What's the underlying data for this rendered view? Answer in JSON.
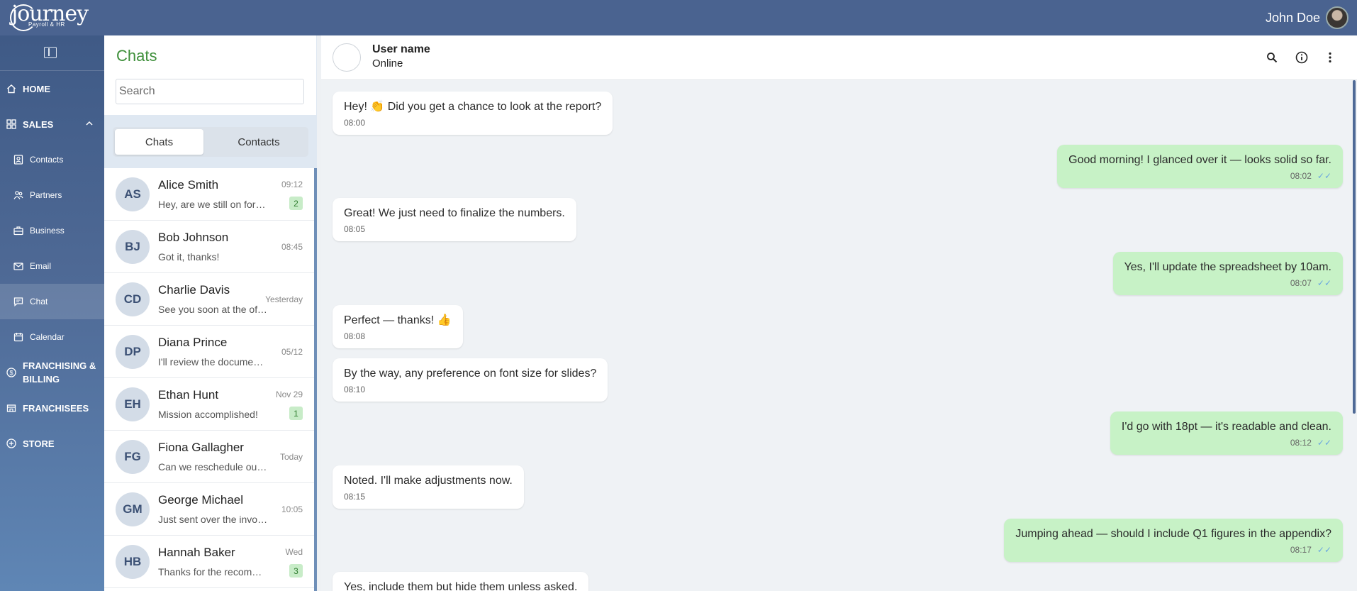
{
  "app": {
    "logo_text": "journey",
    "logo_subtitle": "Payroll & HR"
  },
  "topbar": {
    "user_name": "John Doe"
  },
  "sidebar": {
    "items": [
      {
        "label": "HOME",
        "icon": "home-icon"
      },
      {
        "label": "SALES",
        "icon": "grid-icon"
      },
      {
        "label": "Contacts",
        "icon": "contact-card-icon"
      },
      {
        "label": "Partners",
        "icon": "partners-icon"
      },
      {
        "label": "Business",
        "icon": "briefcase-icon"
      },
      {
        "label": "Email",
        "icon": "mail-icon"
      },
      {
        "label": "Chat",
        "icon": "chat-icon"
      },
      {
        "label": "Calendar",
        "icon": "calendar-icon"
      },
      {
        "label": "FRANCHISING & BILLING",
        "icon": "dollar-icon"
      },
      {
        "label": "FRANCHISEES",
        "icon": "store-icon"
      },
      {
        "label": "STORE",
        "icon": "plus-circle-icon"
      }
    ]
  },
  "chat_panel": {
    "title": "Chats",
    "search_placeholder": "Search",
    "tabs": [
      {
        "label": "Chats",
        "active": true
      },
      {
        "label": "Contacts",
        "active": false
      }
    ],
    "chats": [
      {
        "initials": "AS",
        "name": "Alice Smith",
        "preview": "Hey, are we still on for lunch?",
        "time": "09:12",
        "unread": "2"
      },
      {
        "initials": "BJ",
        "name": "Bob Johnson",
        "preview": "Got it, thanks!",
        "time": "08:45",
        "unread": ""
      },
      {
        "initials": "CD",
        "name": "Charlie Davis",
        "preview": "See you soon at the office",
        "time": "Yesterday",
        "unread": ""
      },
      {
        "initials": "DP",
        "name": "Diana Prince",
        "preview": "I'll review the documents tonight",
        "time": "05/12",
        "unread": ""
      },
      {
        "initials": "EH",
        "name": "Ethan Hunt",
        "preview": "Mission accomplished!",
        "time": "Nov 29",
        "unread": "1"
      },
      {
        "initials": "FG",
        "name": "Fiona Gallagher",
        "preview": "Can we reschedule our call?",
        "time": "Today",
        "unread": ""
      },
      {
        "initials": "GM",
        "name": "George Michael",
        "preview": "Just sent over the invoice",
        "time": "10:05",
        "unread": ""
      },
      {
        "initials": "HB",
        "name": "Hannah Baker",
        "preview": "Thanks for the recommendation",
        "time": "Wed",
        "unread": "3"
      }
    ]
  },
  "conversation": {
    "contact_name": "User name",
    "contact_status": "Online",
    "messages": [
      {
        "dir": "in",
        "text": "Hey! 👏 Did you get a chance to look at the report?",
        "time": "08:00"
      },
      {
        "dir": "out",
        "text": "Good morning! I glanced over it — looks solid so far.",
        "time": "08:02"
      },
      {
        "dir": "in",
        "text": "Great! We just need to finalize the numbers.",
        "time": "08:05"
      },
      {
        "dir": "out",
        "text": "Yes, I'll update the spreadsheet by 10am.",
        "time": "08:07"
      },
      {
        "dir": "in",
        "text": "Perfect — thanks! 👍",
        "time": "08:08"
      },
      {
        "dir": "in",
        "text": "By the way, any preference on font size for slides?",
        "time": "08:10"
      },
      {
        "dir": "out",
        "text": "I'd go with 18pt — it's readable and clean.",
        "time": "08:12"
      },
      {
        "dir": "in",
        "text": "Noted. I'll make adjustments now.",
        "time": "08:15"
      },
      {
        "dir": "out",
        "text": "Jumping ahead — should I include Q1 figures in the appendix?",
        "time": "08:17"
      },
      {
        "dir": "in",
        "text": "Yes, include them but hide them unless asked.",
        "time": ""
      }
    ]
  },
  "colors": {
    "topbar": "#4a6390",
    "accent_green": "#3e8f3a",
    "outgoing_bubble": "#c7f2c6",
    "read_tick": "#6aa6e0"
  }
}
